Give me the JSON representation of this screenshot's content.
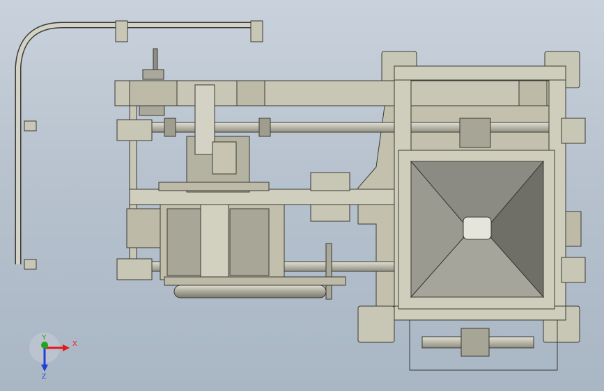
{
  "triad": {
    "x_label": "X",
    "y_label": "Y",
    "z_label": "Z",
    "x_color": "#e31a1c",
    "y_color": "#1fa51f",
    "z_color": "#1f3fd6"
  },
  "colors": {
    "background_top": "#c9d2dc",
    "background_bottom": "#a9b6c4",
    "frame_fill": "#c8c6b4",
    "frame_stroke": "#3a3a34",
    "hopper_inner": "#8d8c84",
    "hopper_dark": "#5f5e58"
  }
}
